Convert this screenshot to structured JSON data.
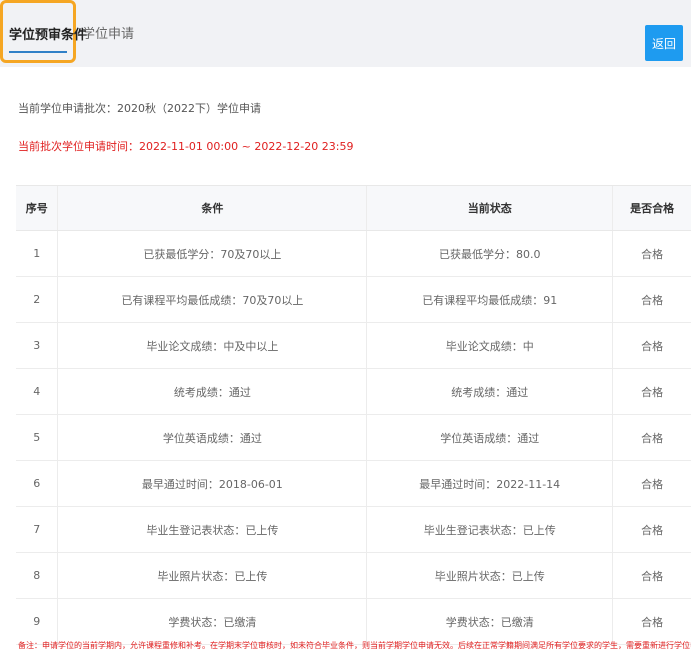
{
  "tabs": {
    "active_label": "学位预审条件",
    "apply_label": "学位申请"
  },
  "back_label": "返回",
  "batch_text": "当前学位申请批次：2020秋（2022下）学位申请",
  "apply_time_text": "当前批次学位申请时间：2022-11-01 00:00 ~ 2022-12-20 23:59",
  "table": {
    "headers": [
      "序号",
      "条件",
      "当前状态",
      "是否合格"
    ],
    "rows": [
      [
        "1",
        "已获最低学分：70及70以上",
        "已获最低学分：80.0",
        "合格"
      ],
      [
        "2",
        "已有课程平均最低成绩：70及70以上",
        "已有课程平均最低成绩：91",
        "合格"
      ],
      [
        "3",
        "毕业论文成绩：中及中以上",
        "毕业论文成绩：中",
        "合格"
      ],
      [
        "4",
        "统考成绩：通过",
        "统考成绩：通过",
        "合格"
      ],
      [
        "5",
        "学位英语成绩：通过",
        "学位英语成绩：通过",
        "合格"
      ],
      [
        "6",
        "最早通过时间：2018-06-01",
        "最早通过时间：2022-11-14",
        "合格"
      ],
      [
        "7",
        "毕业生登记表状态：已上传",
        "毕业生登记表状态：已上传",
        "合格"
      ],
      [
        "8",
        "毕业照片状态：已上传",
        "毕业照片状态：已上传",
        "合格"
      ],
      [
        "9",
        "学费状态：已缴清",
        "学费状态：已缴清",
        "合格"
      ]
    ]
  },
  "note_text": "备注：申请学位的当前学期内，允许课程重修和补考。在学期末学位审核时，如未符合毕业条件，则当前学期学位申请无效。后续在正常学籍期间满足所有学位要求的学生，需要重新进行学位申请。",
  "colors": {
    "accent": "#1e9bf0",
    "highlight_border": "#f5a623",
    "alert_text": "#e02020"
  }
}
